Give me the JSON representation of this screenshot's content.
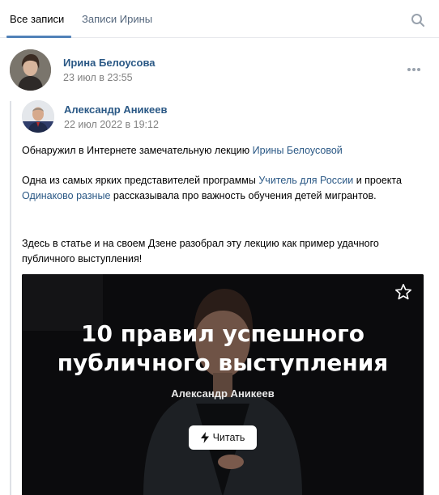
{
  "tabs": {
    "all_posts": "Все записи",
    "user_posts": "Записи Ирины"
  },
  "post": {
    "author": "Ирина Белоусова",
    "date": "23 июл в 23:55"
  },
  "repost": {
    "author": "Александр Аникеев",
    "date": "22 июл 2022 в 19:12",
    "p1_text": "Обнаружил в Интернете замечательную лекцию ",
    "p1_link": "Ирины Белоусовой",
    "p2_text_a": "Одна из самых ярких представителей программы ",
    "p2_link_a": "Учитель для России",
    "p2_text_b": " и проекта ",
    "p2_link_b": "Одинаково разные",
    "p2_text_c": " рассказывала про важность обучения детей мигрантов.",
    "p3_text": "Здесь в статье и на своем Дзене разобрал эту лекцию как пример удачного публичного выступления!"
  },
  "card": {
    "title_line1": "10 правил успешного",
    "title_line2": "публичного выступления",
    "author": "Александр Аникеев",
    "read_label": "Читать"
  },
  "colors": {
    "accent": "#5181b8",
    "link": "#2a5885",
    "muted": "#828282",
    "card_bg": "#0b0b0d"
  },
  "icons": [
    "search-icon",
    "more-icon",
    "star-icon",
    "bolt-icon"
  ]
}
